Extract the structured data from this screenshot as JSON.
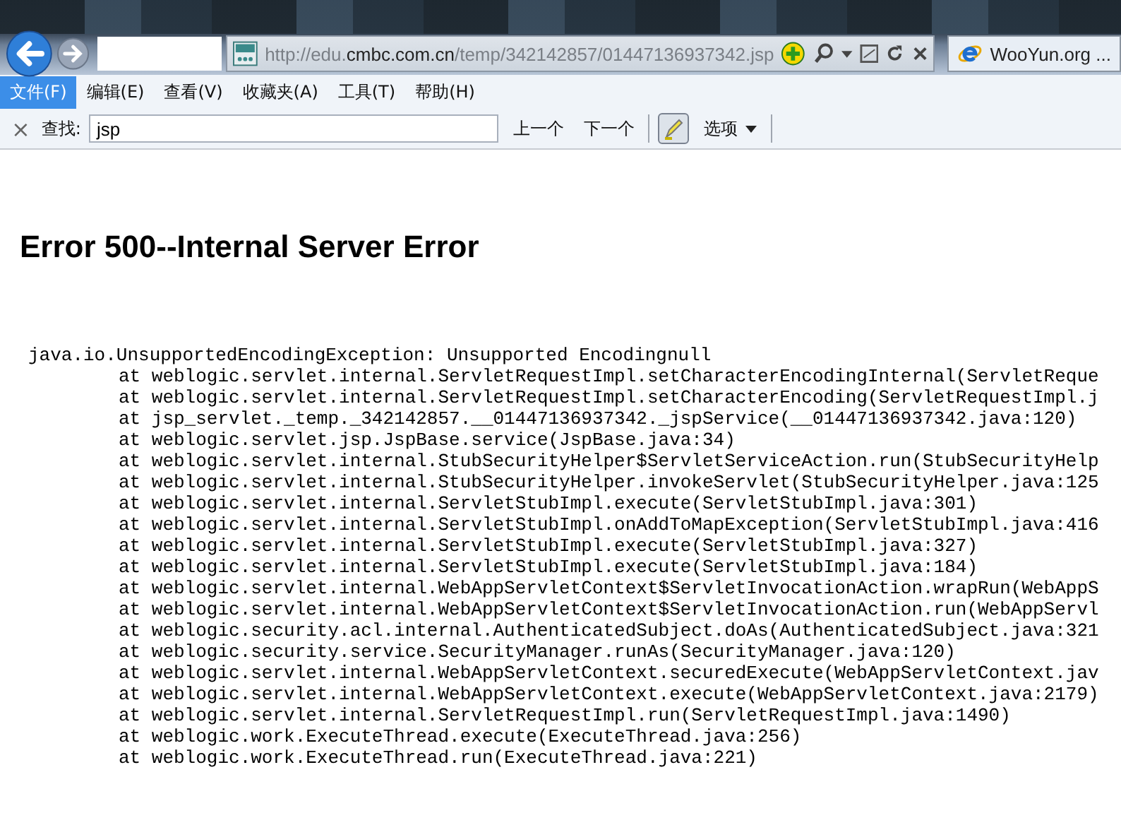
{
  "address_bar": {
    "url_prefix": "http://edu.",
    "url_domain": "cmbc.com.cn",
    "url_path": "/temp/342142857/01447136937342.jsp"
  },
  "tabs": [
    {
      "label": "WooYun.org ...",
      "selected": true
    }
  ],
  "menu": [
    {
      "label": "文件(F)",
      "selected": true
    },
    {
      "label": "编辑(E)",
      "selected": false
    },
    {
      "label": "查看(V)",
      "selected": false
    },
    {
      "label": "收藏夹(A)",
      "selected": false
    },
    {
      "label": "工具(T)",
      "selected": false
    },
    {
      "label": "帮助(H)",
      "selected": false
    }
  ],
  "find_bar": {
    "close": "×",
    "label": "查找:",
    "value": "jsp",
    "prev": "上一个",
    "next": "下一个",
    "highlight_on": true,
    "options": "选项"
  },
  "page": {
    "heading": "Error 500--Internal Server Error",
    "exception": "java.io.UnsupportedEncodingException: Unsupported Encodingnull",
    "frames": [
      "at weblogic.servlet.internal.ServletRequestImpl.setCharacterEncodingInternal(ServletReque",
      "at weblogic.servlet.internal.ServletRequestImpl.setCharacterEncoding(ServletRequestImpl.j",
      "at jsp_servlet._temp._342142857.__01447136937342._jspService(__01447136937342.java:120)",
      "at weblogic.servlet.jsp.JspBase.service(JspBase.java:34)",
      "at weblogic.servlet.internal.StubSecurityHelper$ServletServiceAction.run(StubSecurityHelp",
      "at weblogic.servlet.internal.StubSecurityHelper.invokeServlet(StubSecurityHelper.java:125",
      "at weblogic.servlet.internal.ServletStubImpl.execute(ServletStubImpl.java:301)",
      "at weblogic.servlet.internal.ServletStubImpl.onAddToMapException(ServletStubImpl.java:416",
      "at weblogic.servlet.internal.ServletStubImpl.execute(ServletStubImpl.java:327)",
      "at weblogic.servlet.internal.ServletStubImpl.execute(ServletStubImpl.java:184)",
      "at weblogic.servlet.internal.WebAppServletContext$ServletInvocationAction.wrapRun(WebAppS",
      "at weblogic.servlet.internal.WebAppServletContext$ServletInvocationAction.run(WebAppServl",
      "at weblogic.security.acl.internal.AuthenticatedSubject.doAs(AuthenticatedSubject.java:321",
      "at weblogic.security.service.SecurityManager.runAs(SecurityManager.java:120)",
      "at weblogic.servlet.internal.WebAppServletContext.securedExecute(WebAppServletContext.jav",
      "at weblogic.servlet.internal.WebAppServletContext.execute(WebAppServletContext.java:2179)",
      "at weblogic.servlet.internal.ServletRequestImpl.run(ServletRequestImpl.java:1490)",
      "at weblogic.work.ExecuteThread.execute(ExecuteThread.java:256)",
      "at weblogic.work.ExecuteThread.run(ExecuteThread.java:221)"
    ]
  }
}
